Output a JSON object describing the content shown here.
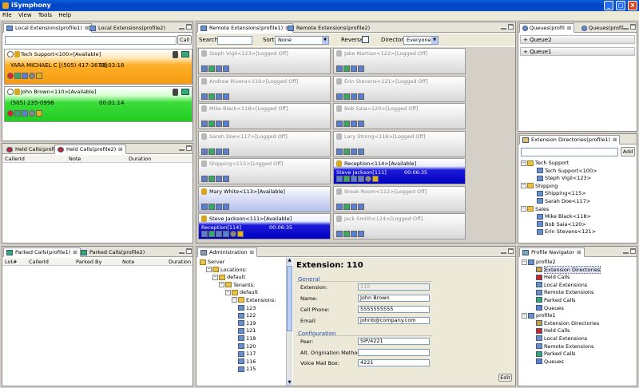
{
  "window": {
    "title": "iSymphony",
    "min": "_",
    "max": "□",
    "close": "X"
  },
  "menu": [
    "File",
    "View",
    "Tools",
    "Help"
  ],
  "local_ext": {
    "tabs": [
      "Local Extensions(profile1)",
      "Local Extensions(profile2)"
    ],
    "call_button": "Call",
    "rows": [
      {
        "name": "Tech Support<100>[Available]",
        "caller": "YARA MICHAEL C [(505) 417-3670]",
        "time": "00:03:18"
      },
      {
        "name": "John Brown<110>[Available]",
        "caller": "(505) 235-0998",
        "time": "00:01:14"
      }
    ]
  },
  "held": {
    "tabs": [
      "Held Calls(profile1)",
      "Held Calls(profile2)"
    ],
    "cols": [
      "CallerId",
      "Note",
      "Duration"
    ]
  },
  "parked": {
    "tabs": [
      "Parked Calls(profile1)",
      "Parked Calls(profile2)"
    ],
    "cols": [
      "Lot#",
      "CallerId",
      "Parked By",
      "Note",
      "Duration"
    ]
  },
  "remote": {
    "tabs": [
      "Remote Extensions(profile1)",
      "Remote Extensions(profile2)"
    ],
    "search_label": "Search:",
    "sort_label": "Sort:",
    "sort_value": "None",
    "reverse_label": "Reverse:",
    "directory_label": "Directory:",
    "directory_value": "Everyone",
    "tiles": [
      {
        "name": "Steph Vigil<123>[Logged Off]",
        "state": "off"
      },
      {
        "name": "Jake Martian<122>[Logged Off]",
        "state": "off"
      },
      {
        "name": "Andrew Rivera<119>[Logged Off]",
        "state": "off"
      },
      {
        "name": "Erin Stevens<121>[Logged Off]",
        "state": "off"
      },
      {
        "name": "Mike Black<118>[Logged Off]",
        "state": "off"
      },
      {
        "name": "Bob Saia<120>[Logged Off]",
        "state": "off"
      },
      {
        "name": "Sarah Doe<117>[Logged Off]",
        "state": "off"
      },
      {
        "name": "Lary Strong<116>[Logged Off]",
        "state": "off"
      },
      {
        "name": "Shipping<115>[Logged Off]",
        "state": "off"
      },
      {
        "name": "Reception<114>[Available]",
        "state": "call",
        "caller": "Steve Jackson[111]",
        "time": "00:06:35"
      },
      {
        "name": "Mary White<113>[Available]",
        "state": "on"
      },
      {
        "name": "Break Room<112>[Logged Off]",
        "state": "off"
      },
      {
        "name": "Steve Jackson<111>[Available]",
        "state": "call",
        "caller": "Reception[114]",
        "time": "00:06:35"
      },
      {
        "name": "Jack Smith<124>[Logged Off]",
        "state": "off"
      }
    ]
  },
  "queues": {
    "tabs": [
      "Queues(profil",
      "Queues(profil"
    ],
    "items": [
      "+ Queue2",
      "+ Queue1"
    ]
  },
  "ext_dir": {
    "tab": "Extension Directories(profile1)",
    "add_button": "Add",
    "groups": [
      {
        "name": "Tech Support",
        "items": [
          "Tech Support<100>",
          "Steph Vigil<123>"
        ]
      },
      {
        "name": "Shipping",
        "items": [
          "Shipping<115>",
          "Sarah Doe<117>"
        ]
      },
      {
        "name": "Sales",
        "items": [
          "Mike Black<118>",
          "Bob Saia<120>",
          "Erin Stevens<121>"
        ]
      }
    ]
  },
  "admin": {
    "tab": "Administration",
    "tree": [
      "Server",
      "Locations:",
      "default",
      "Tenants:",
      "default",
      "Extensions:",
      "123",
      "122",
      "119",
      "121",
      "118",
      "120",
      "117",
      "116",
      "115"
    ],
    "heading": "Extension: 110",
    "general": "General",
    "fields": [
      {
        "label": "Extension:",
        "value": "110"
      },
      {
        "label": "Name:",
        "value": "John Brown"
      },
      {
        "label": "Cell Phone:",
        "value": "5555555555"
      },
      {
        "label": "Email:",
        "value": "johnb@company.com"
      }
    ],
    "configuration": "Configuration",
    "config_fields": [
      {
        "label": "Peer:",
        "value": "SIP/4221"
      },
      {
        "label": "Alt. Origination Method:",
        "value": ""
      },
      {
        "label": "Voice Mail Box:",
        "value": "4221"
      }
    ],
    "edit_button": "Edit"
  },
  "profile_nav": {
    "tab": "Profile Navigator",
    "profiles": [
      {
        "name": "profile2",
        "items": [
          "Extension Directories",
          "Held Calls",
          "Local Extensions",
          "Remote Extensions",
          "Parked Calls",
          "Queues"
        ]
      },
      {
        "name": "profile1",
        "items": [
          "Extension Directories",
          "Held Calls",
          "Local Extensions",
          "Remote Extensions",
          "Parked Calls",
          "Queues"
        ]
      }
    ]
  }
}
